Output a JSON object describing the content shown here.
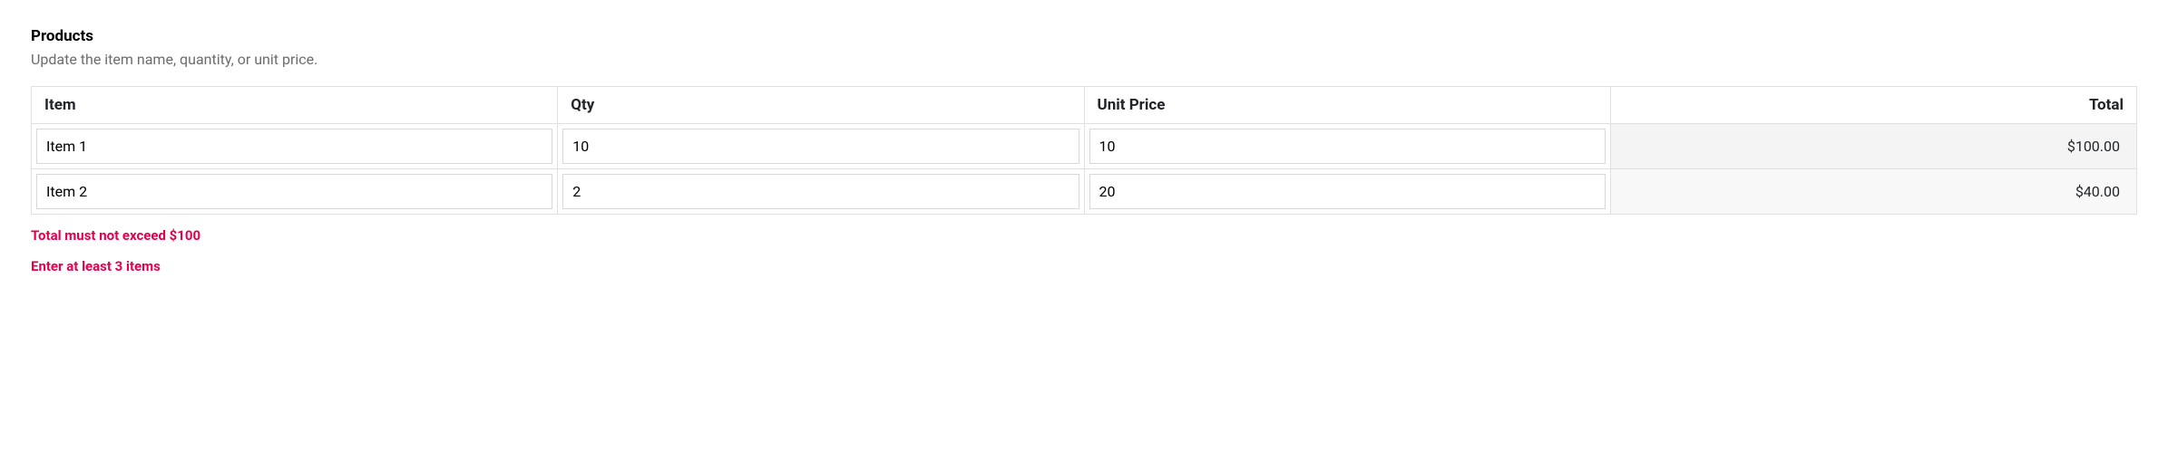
{
  "section": {
    "title": "Products",
    "subtitle": "Update the item name, quantity, or unit price."
  },
  "table": {
    "headers": {
      "item": "Item",
      "qty": "Qty",
      "unit_price": "Unit Price",
      "total": "Total"
    },
    "rows": [
      {
        "item": "Item 1",
        "qty": "10",
        "unit_price": "10",
        "total": "$100.00"
      },
      {
        "item": "Item 2",
        "qty": "2",
        "unit_price": "20",
        "total": "$40.00"
      }
    ]
  },
  "errors": [
    "Total must not exceed $100",
    "Enter at least 3 items"
  ]
}
